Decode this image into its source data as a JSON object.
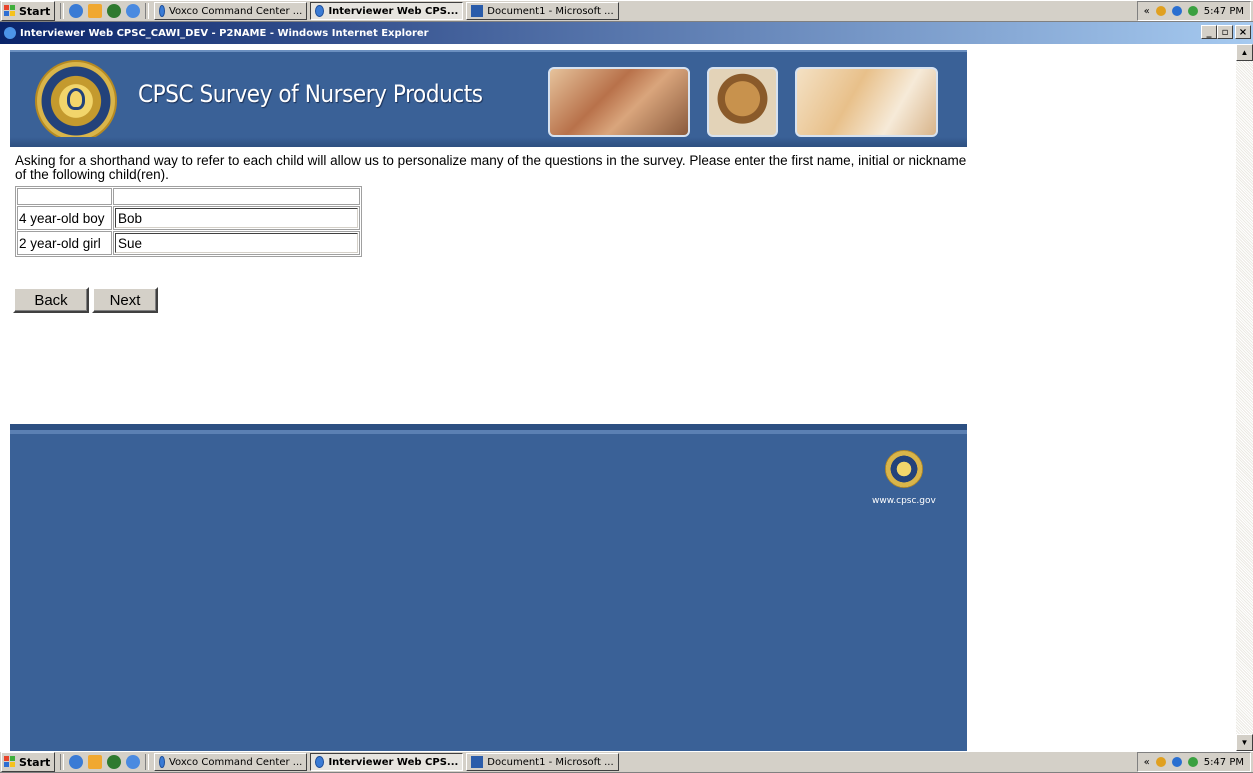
{
  "taskbar": {
    "start_label": "Start",
    "tasks": [
      {
        "label": "Voxco Command Center ..."
      },
      {
        "label": "Interviewer Web CPS..."
      },
      {
        "label": "Document1 - Microsoft ..."
      }
    ],
    "tray_chevron": "«",
    "clock": "5:47 PM"
  },
  "window": {
    "title": "Interviewer Web CPSC_CAWI_DEV - P2NAME - Windows Internet Explorer",
    "minimize_label": "_",
    "maximize_label": "▫",
    "close_label": "×"
  },
  "header": {
    "site_title": "CPSC Survey of Nursery Products"
  },
  "survey": {
    "question": "Asking for a shorthand way to refer to each child will allow us to personalize many of the questions in the survey. Please enter the first name, initial or nickname of the following child(ren).",
    "rows": [
      {
        "label": "4 year-old boy",
        "value": "Bob"
      },
      {
        "label": "2 year-old girl",
        "value": "Sue"
      }
    ],
    "back_label": "Back",
    "next_label": "Next"
  },
  "footer": {
    "url": "www.cpsc.gov"
  },
  "scrollbar": {
    "up_arrow": "▲",
    "down_arrow": "▼"
  },
  "colors": {
    "header_blue": "#3a6197",
    "titlebar_start": "#0a246a",
    "taskbar_gray": "#d4d0c8"
  }
}
